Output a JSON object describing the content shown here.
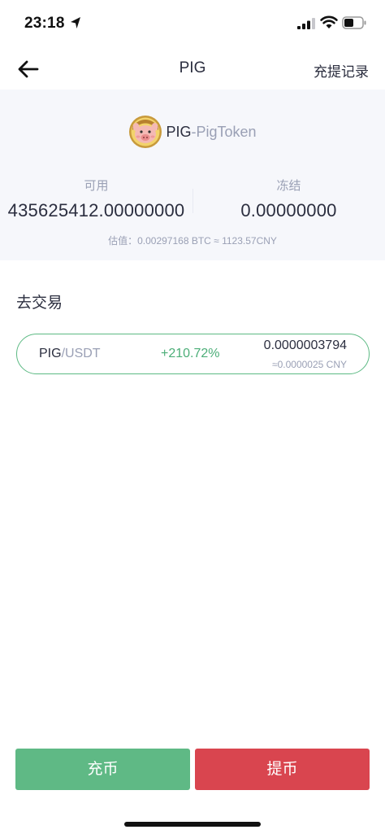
{
  "status_bar": {
    "time": "23:18"
  },
  "nav": {
    "title": "PIG",
    "history_label": "充提记录"
  },
  "coin": {
    "symbol": "PIG",
    "separator": "-",
    "name": "PigToken"
  },
  "balance": {
    "available_label": "可用",
    "available_value": "435625412.00000000",
    "frozen_label": "冻结",
    "frozen_value": "0.00000000",
    "estimate": "估值：0.00297168 BTC ≈ 1123.57CNY"
  },
  "trade": {
    "section_title": "去交易",
    "pair_base": "PIG",
    "pair_quote": "/USDT",
    "change": "+210.72%",
    "price": "0.0000003794",
    "price_cny": "≈0.0000025 CNY"
  },
  "actions": {
    "deposit_label": "充币",
    "withdraw_label": "提币"
  },
  "colors": {
    "up": "#4cae78",
    "deposit": "#5fb985",
    "withdraw": "#d9454f",
    "card_bg": "#f6f7fb"
  }
}
